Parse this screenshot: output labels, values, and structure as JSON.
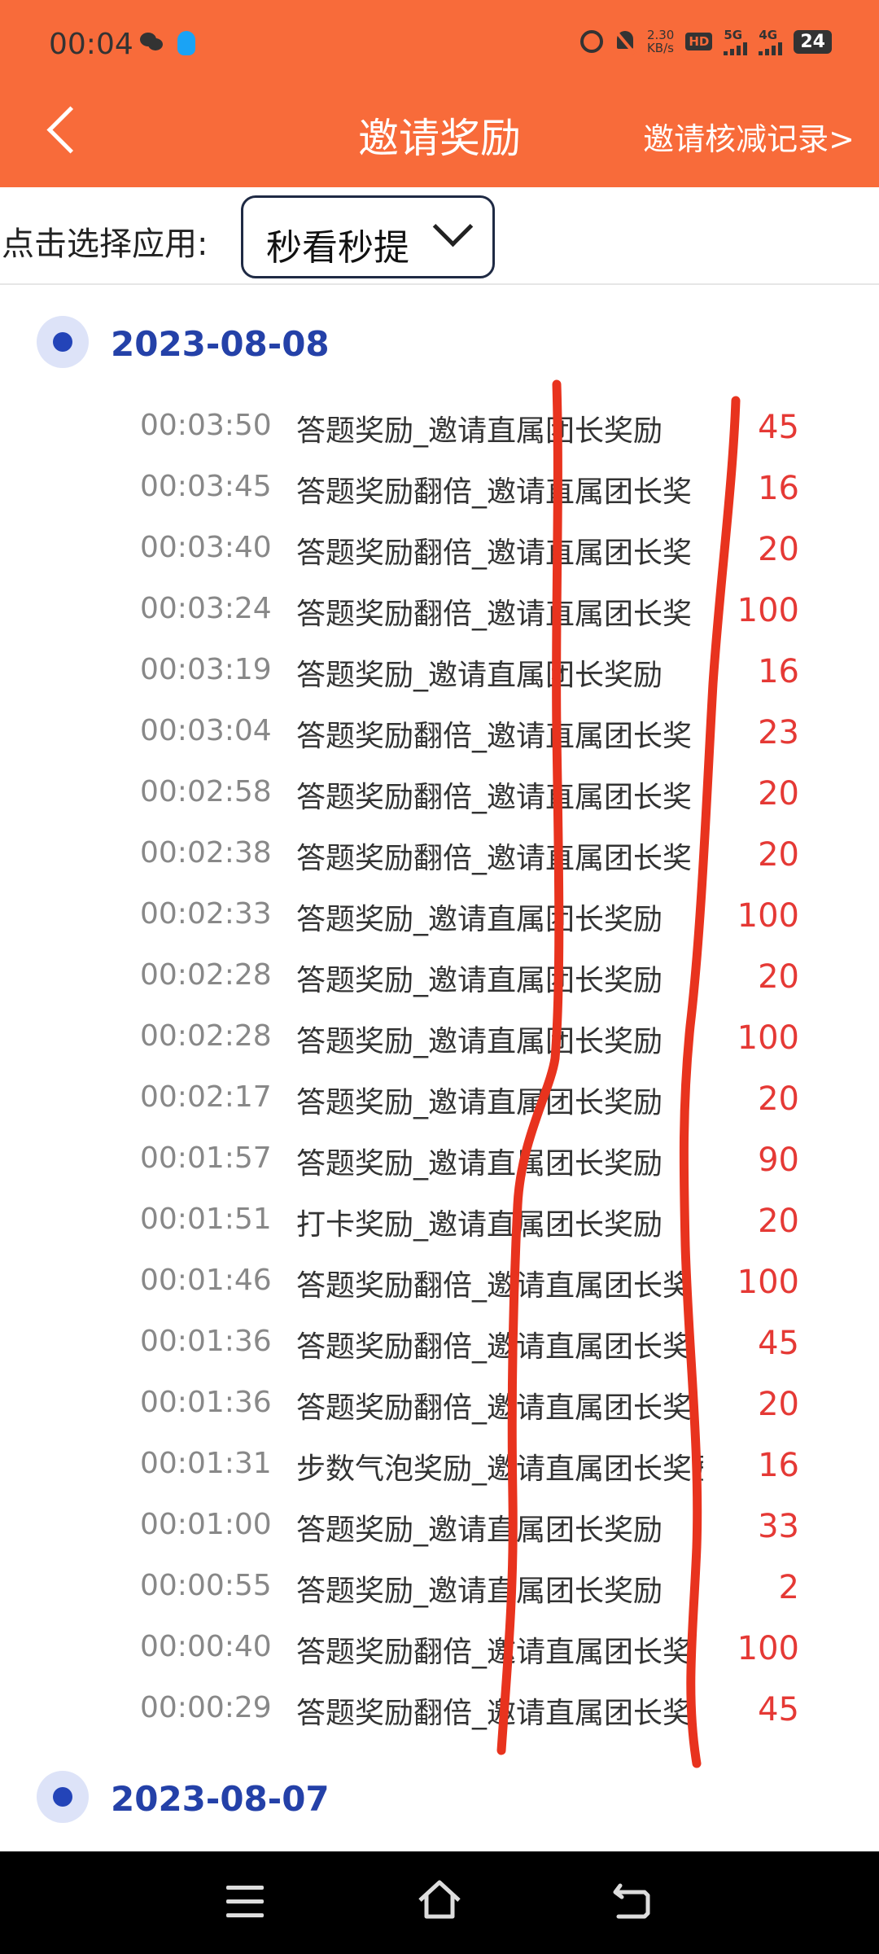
{
  "status_bar": {
    "time": "00:04",
    "net_speed_value": "2.30",
    "net_speed_unit": "KB/s",
    "hd_label": "HD",
    "sim1_label": "5G",
    "sim2_label": "4G",
    "battery": "24"
  },
  "header": {
    "title": "邀请奖励",
    "records_link": "邀请核减记录>"
  },
  "selector": {
    "label": "点击选择应用:",
    "value": "秒看秒提"
  },
  "groups": [
    {
      "date": "2023-08-08",
      "records": [
        {
          "time": "00:03:50",
          "desc": "答题奖励_邀请直属团长奖励",
          "amount": "45"
        },
        {
          "time": "00:03:45",
          "desc": "答题奖励翻倍_邀请直属团长奖",
          "amount": "16"
        },
        {
          "time": "00:03:40",
          "desc": "答题奖励翻倍_邀请直属团长奖",
          "amount": "20"
        },
        {
          "time": "00:03:24",
          "desc": "答题奖励翻倍_邀请直属团长奖",
          "amount": "100"
        },
        {
          "time": "00:03:19",
          "desc": "答题奖励_邀请直属团长奖励",
          "amount": "16"
        },
        {
          "time": "00:03:04",
          "desc": "答题奖励翻倍_邀请直属团长奖",
          "amount": "23"
        },
        {
          "time": "00:02:58",
          "desc": "答题奖励翻倍_邀请直属团长奖",
          "amount": "20"
        },
        {
          "time": "00:02:38",
          "desc": "答题奖励翻倍_邀请直属团长奖",
          "amount": "20"
        },
        {
          "time": "00:02:33",
          "desc": "答题奖励_邀请直属团长奖励",
          "amount": "100"
        },
        {
          "time": "00:02:28",
          "desc": "答题奖励_邀请直属团长奖励",
          "amount": "20"
        },
        {
          "time": "00:02:28",
          "desc": "答题奖励_邀请直属团长奖励",
          "amount": "100"
        },
        {
          "time": "00:02:17",
          "desc": "答题奖励_邀请直属团长奖励",
          "amount": "20"
        },
        {
          "time": "00:01:57",
          "desc": "答题奖励_邀请直属团长奖励",
          "amount": "90"
        },
        {
          "time": "00:01:51",
          "desc": "打卡奖励_邀请直属团长奖励",
          "amount": "20"
        },
        {
          "time": "00:01:46",
          "desc": "答题奖励翻倍_邀请直属团长奖",
          "amount": "100"
        },
        {
          "time": "00:01:36",
          "desc": "答题奖励翻倍_邀请直属团长奖",
          "amount": "45"
        },
        {
          "time": "00:01:36",
          "desc": "答题奖励翻倍_邀请直属团长奖",
          "amount": "20"
        },
        {
          "time": "00:01:31",
          "desc": "步数气泡奖励_邀请直属团长奖励",
          "amount": "16"
        },
        {
          "time": "00:01:00",
          "desc": "答题奖励_邀请直属团长奖励",
          "amount": "33"
        },
        {
          "time": "00:00:55",
          "desc": "答题奖励_邀请直属团长奖励",
          "amount": "2"
        },
        {
          "time": "00:00:40",
          "desc": "答题奖励翻倍_邀请直属团长奖",
          "amount": "100"
        },
        {
          "time": "00:00:29",
          "desc": "答题奖励翻倍_邀请直属团长奖",
          "amount": "45"
        }
      ]
    },
    {
      "date": "2023-08-07",
      "records": []
    }
  ],
  "colors": {
    "header_bg": "#F86B3A",
    "date_text": "#2441A8",
    "amount_text": "#E53935",
    "annotation": "#E8331E"
  },
  "nav_bar": {
    "icons": [
      "menu-icon",
      "home-icon",
      "back-icon"
    ]
  }
}
